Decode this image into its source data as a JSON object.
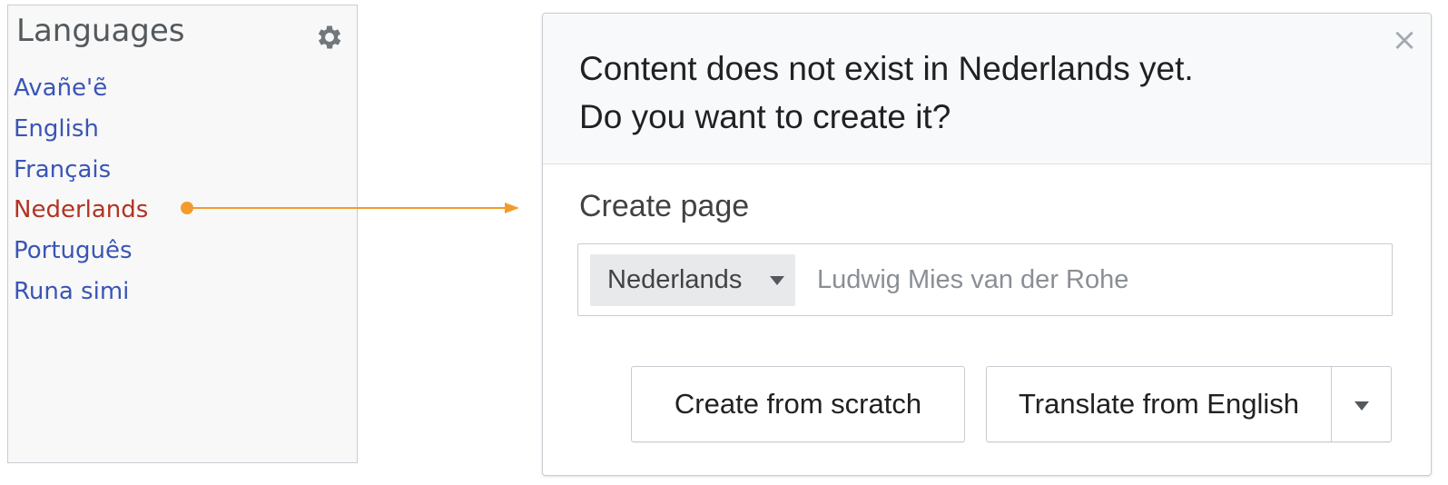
{
  "languages_panel": {
    "title": "Languages",
    "settings_icon": "gear-icon",
    "items": [
      {
        "label": "Avañe'ẽ",
        "active": false
      },
      {
        "label": "English",
        "active": false
      },
      {
        "label": "Français",
        "active": false
      },
      {
        "label": "Nederlands",
        "active": true
      },
      {
        "label": "Português",
        "active": false
      },
      {
        "label": "Runa simi",
        "active": false
      }
    ]
  },
  "connector": {
    "color": "#f39c2b"
  },
  "dialog": {
    "message_line1": "Content does not exist in Nederlands yet.",
    "message_line2": "Do you want to create it?",
    "close_icon": "close-icon",
    "close_glyph": "×",
    "section_label": "Create page",
    "language_select": {
      "value": "Nederlands"
    },
    "title_placeholder": "Ludwig Mies van der Rohe",
    "buttons": {
      "create_from_scratch": "Create from scratch",
      "translate_from": "Translate from English"
    }
  },
  "colors": {
    "link": "#3a55b5",
    "active_link": "#b03424",
    "accent": "#f39c2b"
  }
}
